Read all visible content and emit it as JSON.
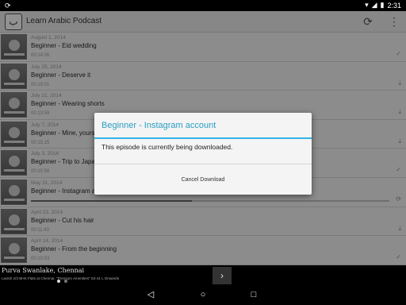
{
  "status_bar": {
    "left_icon": "sync-icon",
    "time": "2:31",
    "icons": [
      "wifi-icon",
      "signal-icon",
      "battery-icon"
    ]
  },
  "app": {
    "title": "Learn Arabic Podcast",
    "logo_icon": "app-logo-icon"
  },
  "episodes": [
    {
      "date": "August 1, 2014",
      "title": "Beginner - Eid wedding",
      "duration": "00:14:06",
      "status": "downloaded"
    },
    {
      "date": "July 25, 2014",
      "title": "Beginner - Deserve it",
      "duration": "00:15:01",
      "status": "download"
    },
    {
      "date": "July 21, 2014",
      "title": "Beginner - Wearing shorts",
      "duration": "00:13:59",
      "status": "download"
    },
    {
      "date": "July 7, 2014",
      "title": "Beginner - Mine, yours and",
      "duration": "00:15:15",
      "status": "download"
    },
    {
      "date": "July 3, 2014",
      "title": "Beginner - Trip to Japan",
      "duration": "00:15:56",
      "status": "downloaded"
    },
    {
      "date": "May 31, 2014",
      "title": "Beginner - Instagram account",
      "duration": "",
      "status": "downloading",
      "progress": 0.45
    },
    {
      "date": "April 23, 2014",
      "title": "Beginner - Cut his hair",
      "duration": "00:11:40",
      "status": "download"
    },
    {
      "date": "April 14, 2014",
      "title": "Beginner - From the beginning",
      "duration": "00:10:53",
      "status": "downloaded"
    }
  ],
  "dialog": {
    "title": "Beginner - Instagram account",
    "message": "This episode is currently being downloaded.",
    "button": "Cancel Download"
  },
  "ad": {
    "title": "Purva Swanlake, Chennai",
    "description": "Lavish 2/3 BHK Flats at Chennai. \"Premium Amenities\" 53-41 L Onwards",
    "arrow_icon": "chevron-right-icon",
    "dots": 2,
    "active_dot": 0
  },
  "nav": {
    "back_icon": "back-icon",
    "home_icon": "home-icon",
    "recents_icon": "recents-icon"
  }
}
